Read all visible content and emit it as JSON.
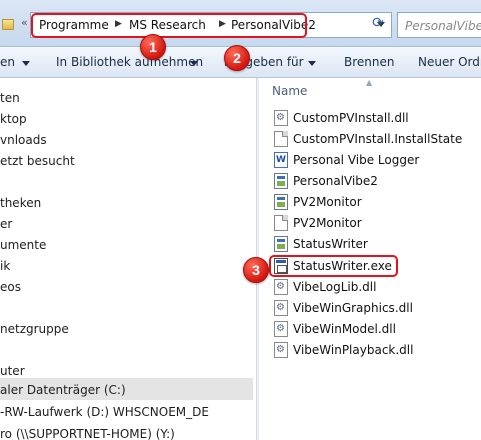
{
  "address": {
    "crumbs": [
      "Programme",
      "MS Research",
      "PersonalVibe2"
    ],
    "search_placeholder": "PersonalVibe2"
  },
  "toolbar": {
    "items": [
      "en",
      "In Bibliothek aufnehmen",
      "Freigeben für",
      "Brennen",
      "Neuer Ordner"
    ]
  },
  "nav": {
    "items": [
      "ten",
      "ktop",
      "vnloads",
      "etzt besucht",
      "theken",
      "er",
      "umente",
      "ik",
      "eos",
      "netzgruppe",
      "uter",
      "aler Datenträger (C:)",
      "-RW-Laufwerk (D:) WHSCNOEM_DE",
      "ro (\\\\SUPPORTNET-HOME) (Y:)"
    ]
  },
  "list": {
    "column_name": "Name",
    "files": [
      {
        "name": "CustomPVInstall.dll",
        "icon": "dll-icon"
      },
      {
        "name": "CustomPVInstall.InstallState",
        "icon": "document-icon"
      },
      {
        "name": "Personal Vibe Logger",
        "icon": "word-document-icon"
      },
      {
        "name": "PersonalVibe2",
        "icon": "application-icon"
      },
      {
        "name": "PV2Monitor",
        "icon": "application-icon"
      },
      {
        "name": "PV2Monitor",
        "icon": "document-icon"
      },
      {
        "name": "StatusWriter",
        "icon": "application-icon"
      },
      {
        "name": "StatusWriter.exe",
        "icon": "exe-icon"
      },
      {
        "name": "VibeLogLib.dll",
        "icon": "dll-icon"
      },
      {
        "name": "VibeWinGraphics.dll",
        "icon": "dll-icon"
      },
      {
        "name": "VibeWinModel.dll",
        "icon": "dll-icon"
      },
      {
        "name": "VibeWinPlayback.dll",
        "icon": "dll-icon"
      }
    ]
  },
  "annotations": {
    "markers": [
      "1",
      "2",
      "3"
    ],
    "highlight_color": "#e0141e"
  }
}
